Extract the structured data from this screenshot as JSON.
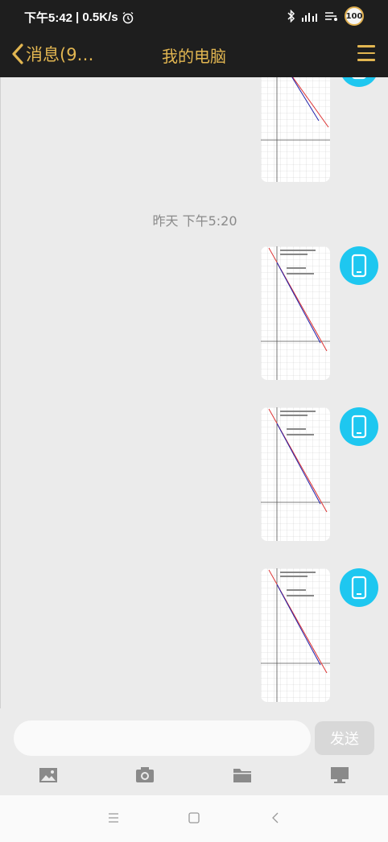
{
  "status_bar": {
    "time": "下午5:42",
    "speed": "| 0.5K/s",
    "battery": "100"
  },
  "header": {
    "back_label": "消息(9…",
    "title": "我的电脑"
  },
  "chat": {
    "timestamp": "昨天 下午5:20",
    "messages": [
      {
        "type": "image",
        "thumbnail": "graph-screenshot"
      },
      {
        "type": "image",
        "thumbnail": "graph-screenshot"
      },
      {
        "type": "image",
        "thumbnail": "graph-screenshot"
      },
      {
        "type": "image",
        "thumbnail": "graph-screenshot"
      }
    ]
  },
  "input": {
    "placeholder": "",
    "send_label": "发送"
  },
  "toolbar": {
    "items": [
      "picture-icon",
      "camera-icon",
      "folder-icon",
      "computer-icon"
    ]
  },
  "colors": {
    "accent": "#e2b651",
    "header_bg": "#1e1e1e",
    "avatar_bg": "#1ec7f0",
    "chat_bg": "#ebebeb"
  }
}
